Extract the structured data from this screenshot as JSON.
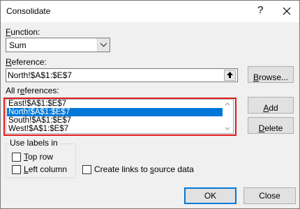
{
  "window": {
    "title": "Consolidate",
    "help_glyph": "?",
    "close_glyph": "✕"
  },
  "function": {
    "label_hotkey": "F",
    "label_rest": "unction:",
    "selected": "Sum"
  },
  "reference": {
    "label_hotkey": "R",
    "label_rest": "eference:",
    "value": "North!$A$1:$E$7"
  },
  "buttons": {
    "browse_hotkey": "B",
    "browse_rest": "rowse...",
    "add_hotkey": "A",
    "add_rest": "dd",
    "delete_hotkey": "D",
    "delete_rest": "elete",
    "ok": "OK",
    "close": "Close"
  },
  "all_references": {
    "label_pre": "All r",
    "label_hotkey": "e",
    "label_post": "ferences:",
    "items": [
      {
        "text": "East!$A$1:$E$7",
        "selected": false
      },
      {
        "text": "North!$A$1:$E$7",
        "selected": true
      },
      {
        "text": "South!$A$1:$E$7",
        "selected": false
      },
      {
        "text": "West!$A$1:$E$7",
        "selected": false
      }
    ]
  },
  "use_labels": {
    "caption": "Use labels in",
    "top_row_hotkey": "T",
    "top_row_rest": "op row",
    "top_row_checked": false,
    "left_column_hotkey": "L",
    "left_column_rest": "eft column",
    "left_column_checked": false
  },
  "links": {
    "label_pre": "Create links to ",
    "label_hotkey": "s",
    "label_post": "ource data",
    "checked": false
  },
  "colors": {
    "selection": "#0078d7",
    "highlight_frame": "#e01b1b",
    "default_button_border": "#0078d7"
  }
}
